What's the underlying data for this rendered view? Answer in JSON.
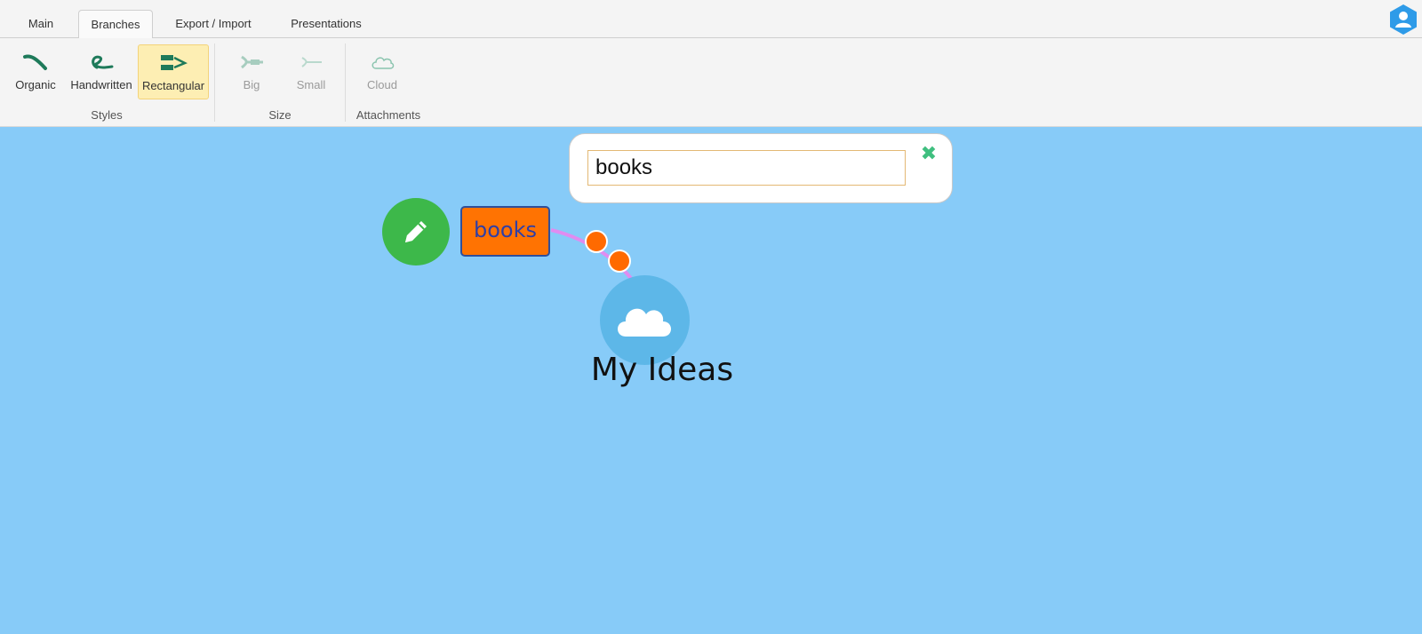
{
  "tabs": [
    {
      "label": "Main",
      "active": false
    },
    {
      "label": "Branches",
      "active": true
    },
    {
      "label": "Export / Import",
      "active": false
    },
    {
      "label": "Presentations",
      "active": false
    }
  ],
  "ribbon": {
    "styles": {
      "group_label": "Styles",
      "organic": "Organic",
      "handwritten": "Handwritten",
      "rectangular": "Rectangular",
      "selected": "Rectangular"
    },
    "size": {
      "group_label": "Size",
      "big": "Big",
      "small": "Small"
    },
    "attachments": {
      "group_label": "Attachments",
      "cloud": "Cloud"
    }
  },
  "editor": {
    "value": "books"
  },
  "map": {
    "child_node": "books",
    "root_node": "My Ideas"
  },
  "icons": {
    "user": "user-avatar-icon",
    "close": "close-icon",
    "edit": "pencil-icon",
    "root": "cloud-icon"
  },
  "colors": {
    "canvas": "#87cbf8",
    "accent_green": "#3fbf7f",
    "edit_button": "#3db84a",
    "node_fill": "#ff7302",
    "node_border": "#2f4f9a",
    "node_text": "#2f3fa6",
    "root_fill": "#5db7e8",
    "connector": "#e08cf0",
    "selected_button": "#fdeeb3"
  }
}
